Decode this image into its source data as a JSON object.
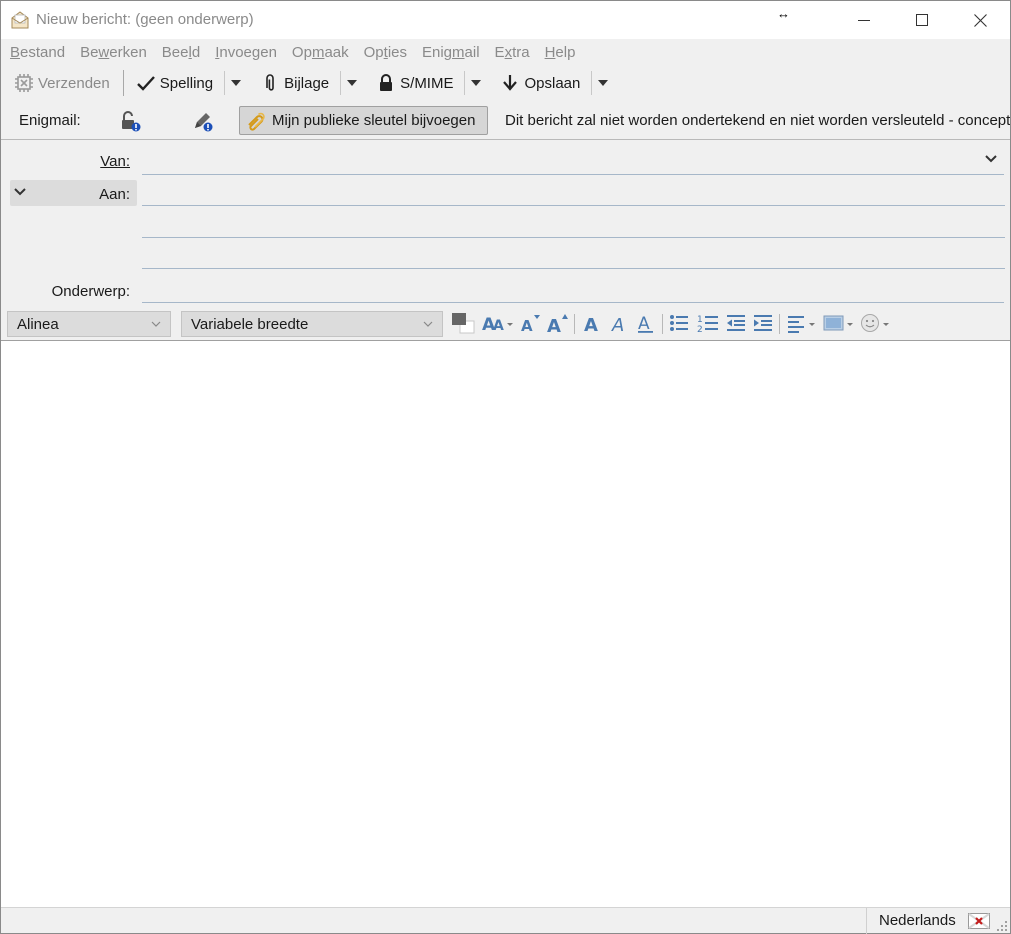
{
  "window": {
    "title": "Nieuw bericht: (geen onderwerp)"
  },
  "menu": [
    {
      "pre": "",
      "acc": "B",
      "post": "estand"
    },
    {
      "pre": "Be",
      "acc": "w",
      "post": "erken"
    },
    {
      "pre": "Bee",
      "acc": "l",
      "post": "d"
    },
    {
      "pre": "",
      "acc": "I",
      "post": "nvoegen"
    },
    {
      "pre": "Op",
      "acc": "m",
      "post": "aak"
    },
    {
      "pre": "Op",
      "acc": "t",
      "post": "ies"
    },
    {
      "pre": "Enig",
      "acc": "m",
      "post": "ail"
    },
    {
      "pre": "E",
      "acc": "x",
      "post": "tra"
    },
    {
      "pre": "",
      "acc": "H",
      "post": "elp"
    }
  ],
  "toolbar": {
    "send_label": "Verzenden",
    "spelling_label": "Spelling",
    "attach_label": "Bijlage",
    "smime_label": "S/MIME",
    "save_label": "Opslaan"
  },
  "enigmail": {
    "label": "Enigmail:",
    "attach_key_label": "Mijn publieke sleutel bijvoegen",
    "status_text": "Dit bericht zal niet worden ondertekend en niet worden versleuteld - concept"
  },
  "header": {
    "from_label": "Van:",
    "from_value": "",
    "to_label": "Aan:",
    "to_value": "",
    "subject_label": "Onderwerp:",
    "subject_value": ""
  },
  "format": {
    "paragraph_value": "Alinea",
    "font_value": "Variabele breedte"
  },
  "statusbar": {
    "language": "Nederlands"
  },
  "colors": {
    "menu_disabled": "#8a8a8a",
    "field_line": "#a6b7c9",
    "icon_blue": "#4a7ab0",
    "badge_blue": "#1c4fb8"
  }
}
